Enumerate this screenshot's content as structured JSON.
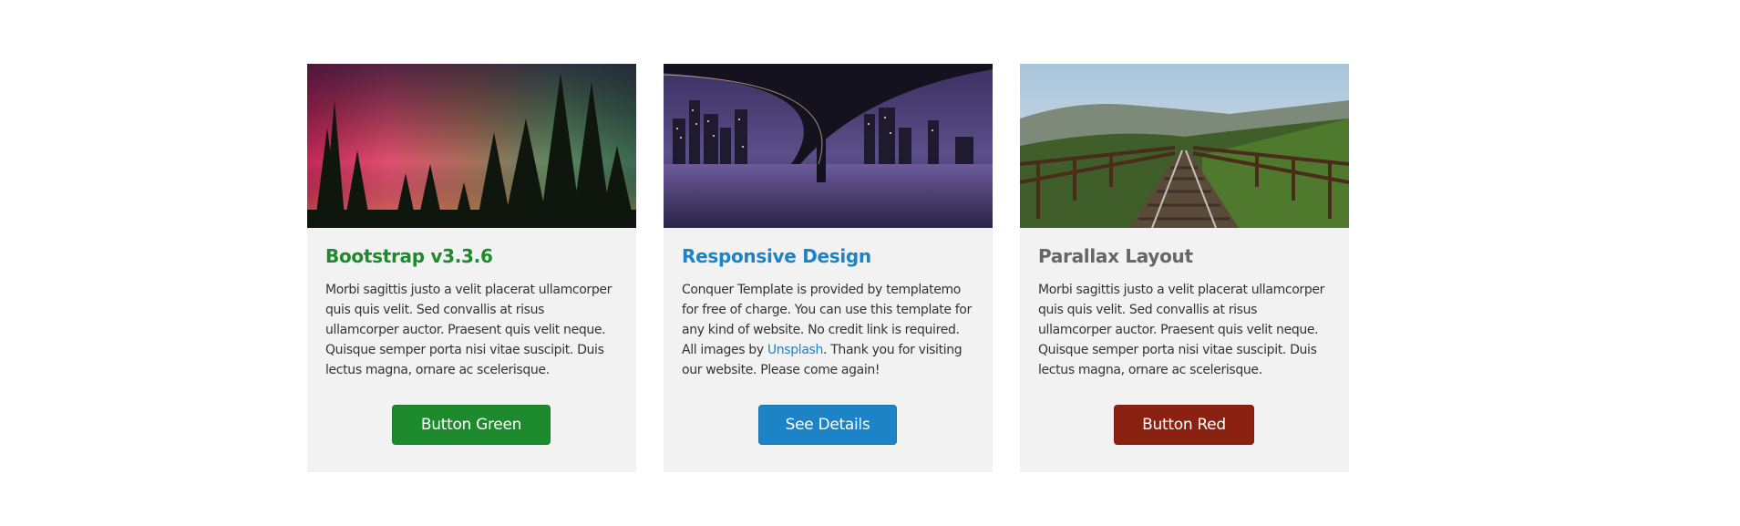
{
  "cards": [
    {
      "image_alt": "aurora-forest-image",
      "title": "Bootstrap v3.3.6",
      "text": "Morbi sagittis justo a velit placerat ullamcorper quis quis velit. Sed convallis at risus ullamcorper auctor. Praesent quis velit neque. Quisque semper porta nisi vitae suscipit. Duis lectus magna, ornare ac scelerisque.",
      "button": "Button Green",
      "title_color": "#1d8a2e",
      "button_color": "#1d8a2e"
    },
    {
      "image_alt": "city-bridge-night-image",
      "title": "Responsive Design",
      "text_before_link": "Conquer Template is provided by templatemo for free of charge. You can use this template for any kind of website. No credit link is required. All images by ",
      "link": "Unsplash",
      "text_after_link": ". Thank you for visiting our website. Please come again!",
      "button": "See Details",
      "title_color": "#1c84c6",
      "button_color": "#1c84c6"
    },
    {
      "image_alt": "railway-bridge-image",
      "title": "Parallax Layout",
      "text": "Morbi sagittis justo a velit placerat ullamcorper quis quis velit. Sed convallis at risus ullamcorper auctor. Praesent quis velit neque. Quisque semper porta nisi vitae suscipit. Duis lectus magna, ornare ac scelerisque.",
      "button": "Button Red",
      "title_color": "#666666",
      "button_color": "#8b2111"
    }
  ]
}
